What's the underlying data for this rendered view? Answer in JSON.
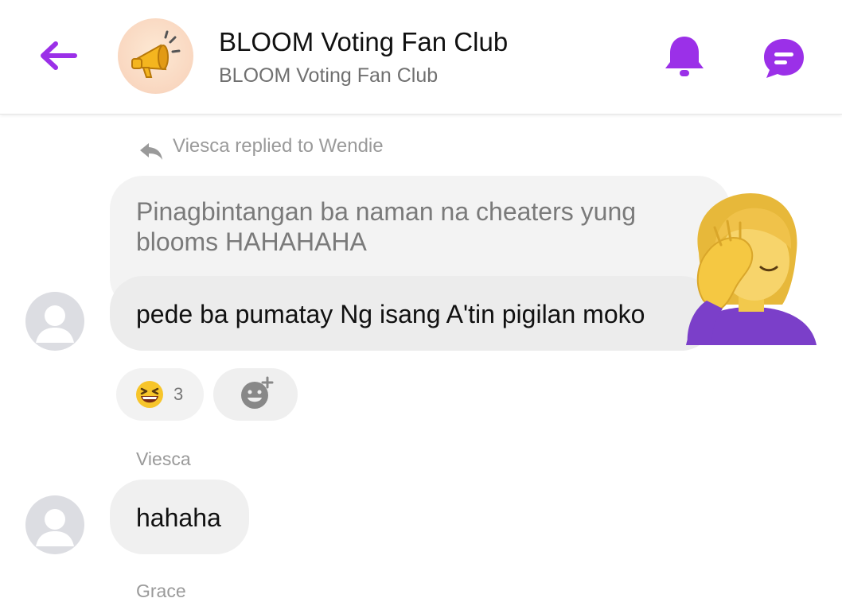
{
  "header": {
    "title": "BLOOM Voting Fan Club",
    "subtitle": "BLOOM Voting Fan Club",
    "back_icon": "arrow-left-icon",
    "group_icon": "megaphone-icon",
    "bell_icon": "bell-icon",
    "chat_icon": "chat-bubble-icon",
    "accent_color": "#9b30e8"
  },
  "messages": [
    {
      "reply_note": "Viesca replied to Wendie",
      "quoted_text": "Pinagbintangan ba naman na cheaters yung blooms HAHAHAHA",
      "text": "pede ba pumatay Ng isang A'tin pigilan moko",
      "sticker": "woman-facepalming-emoji",
      "reactions": [
        {
          "emoji": "grinning-squinting-face-emoji",
          "count": "3"
        }
      ],
      "add_reaction_icon": "add-reaction-icon"
    },
    {
      "sender": "Viesca",
      "text": "hahaha"
    },
    {
      "sender": "Grace"
    }
  ]
}
